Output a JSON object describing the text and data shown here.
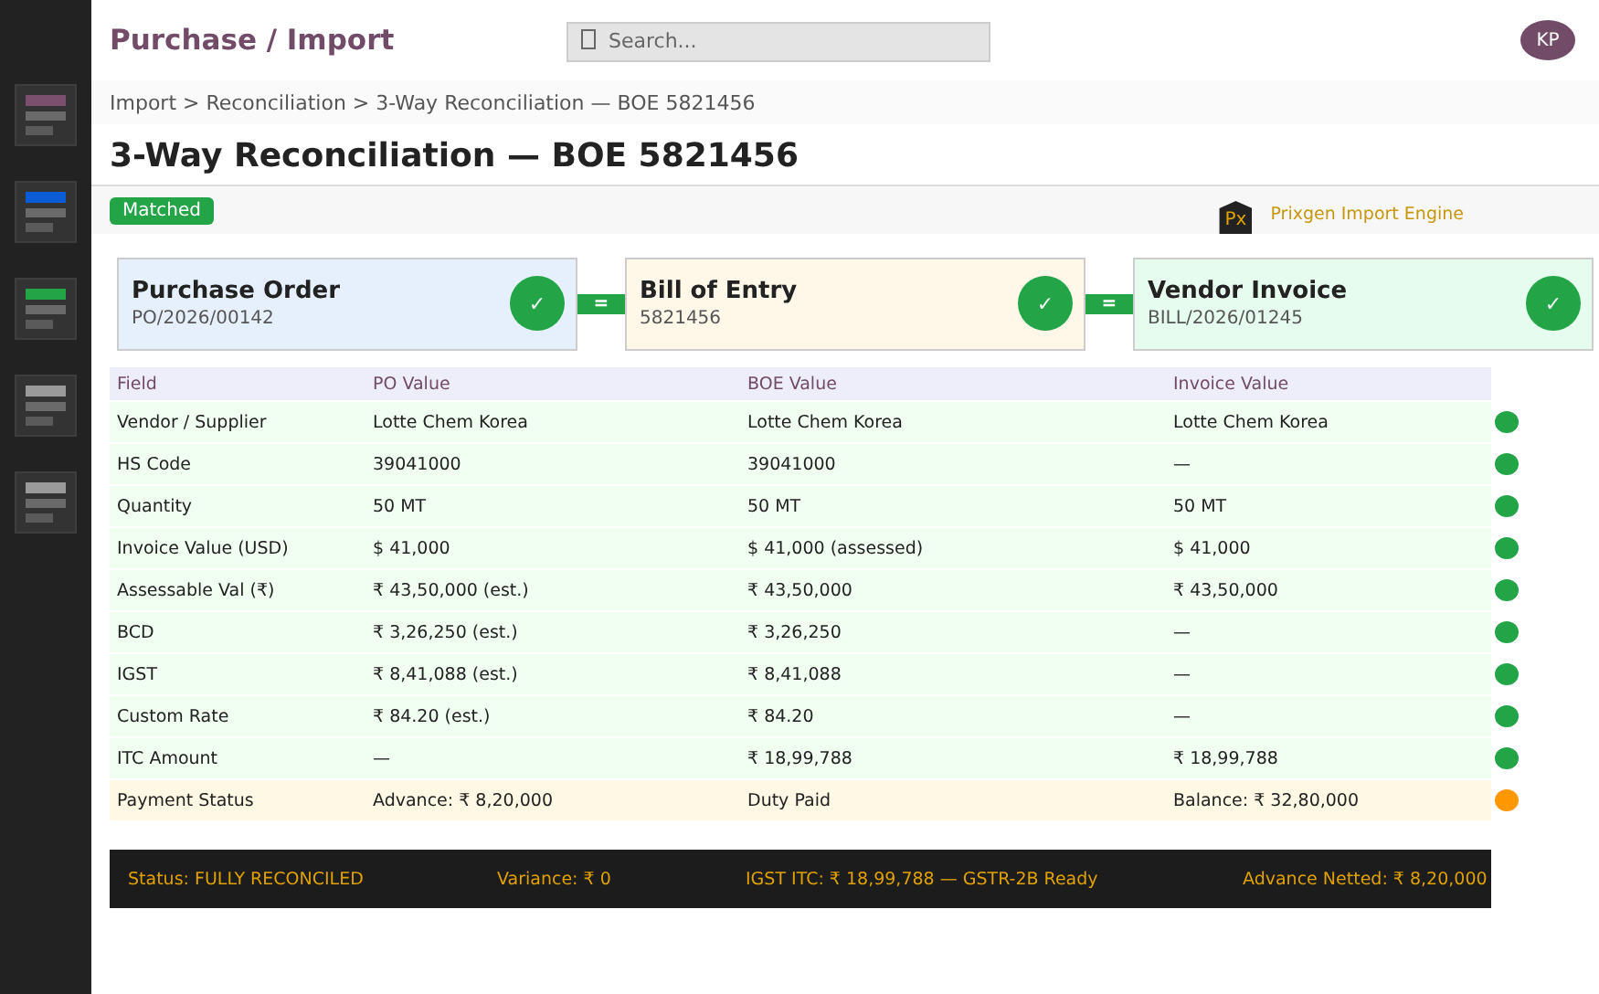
{
  "app_title": "Purchase / Import",
  "search": {
    "placeholder": "Search..."
  },
  "user": {
    "initials": "KP"
  },
  "sidebar": {
    "items": [
      {
        "color": "#7b4f6e"
      },
      {
        "color": "#0b5cd6"
      },
      {
        "color": "#22a447"
      },
      {
        "color": "#9a9a9a"
      },
      {
        "color": "#9a9a9a"
      }
    ]
  },
  "breadcrumb": "Import > Reconciliation > 3-Way Reconciliation — BOE 5821456",
  "page_title": "3-Way Reconciliation — BOE 5821456",
  "status_badge": "Matched",
  "engine": {
    "logo": "Px",
    "name": "Prixgen Import Engine"
  },
  "documents": [
    {
      "kind": "po",
      "title": "Purchase Order",
      "number": "PO/2026/00142",
      "check": "✓"
    },
    {
      "kind": "boe",
      "title": "Bill of Entry",
      "number": "5821456",
      "check": "✓"
    },
    {
      "kind": "invoice",
      "title": "Vendor Invoice",
      "number": "BILL/2026/01245",
      "check": "✓"
    }
  ],
  "connectors": [
    "=",
    "="
  ],
  "table": {
    "columns": [
      "Field",
      "PO Value",
      "BOE Value",
      "Invoice Value"
    ],
    "rows": [
      {
        "cells": [
          "Vendor / Supplier",
          "Lotte Chem Korea",
          "Lotte Chem Korea",
          "Lotte Chem Korea"
        ],
        "color": "#22a447",
        "highlighted": false
      },
      {
        "cells": [
          "HS Code",
          "39041000",
          "39041000",
          "—"
        ],
        "color": "#22a447",
        "highlighted": false
      },
      {
        "cells": [
          "Quantity",
          "50 MT",
          "50 MT",
          "50 MT"
        ],
        "color": "#22a447",
        "highlighted": false
      },
      {
        "cells": [
          "Invoice Value (USD)",
          "$ 41,000",
          "$ 41,000 (assessed)",
          "$ 41,000"
        ],
        "color": "#22a447",
        "highlighted": false
      },
      {
        "cells": [
          "Assessable Val (₹)",
          "₹ 43,50,000 (est.)",
          "₹ 43,50,000",
          "₹ 43,50,000"
        ],
        "color": "#22a447",
        "highlighted": false
      },
      {
        "cells": [
          "BCD",
          "₹ 3,26,250 (est.)",
          "₹ 3,26,250",
          "—"
        ],
        "color": "#22a447",
        "highlighted": false
      },
      {
        "cells": [
          "IGST",
          "₹ 8,41,088 (est.)",
          "₹ 8,41,088",
          "—"
        ],
        "color": "#22a447",
        "highlighted": false
      },
      {
        "cells": [
          "Custom Rate",
          "₹ 84.20 (est.)",
          "₹ 84.20",
          "—"
        ],
        "color": "#22a447",
        "highlighted": false
      },
      {
        "cells": [
          "ITC Amount",
          "—",
          "₹ 18,99,788",
          "₹ 18,99,788"
        ],
        "color": "#22a447",
        "highlighted": false
      },
      {
        "cells": [
          "Payment Status",
          "Advance: ₹ 8,20,000",
          "Duty Paid",
          "Balance: ₹ 32,80,000"
        ],
        "color": "#ff9800",
        "highlighted": true
      }
    ]
  },
  "summary": [
    "Status: FULLY RECONCILED",
    "Variance: ₹ 0",
    "IGST ITC: ₹ 18,99,788 — GSTR-2B Ready",
    "Advance Netted: ₹ 8,20,000"
  ]
}
